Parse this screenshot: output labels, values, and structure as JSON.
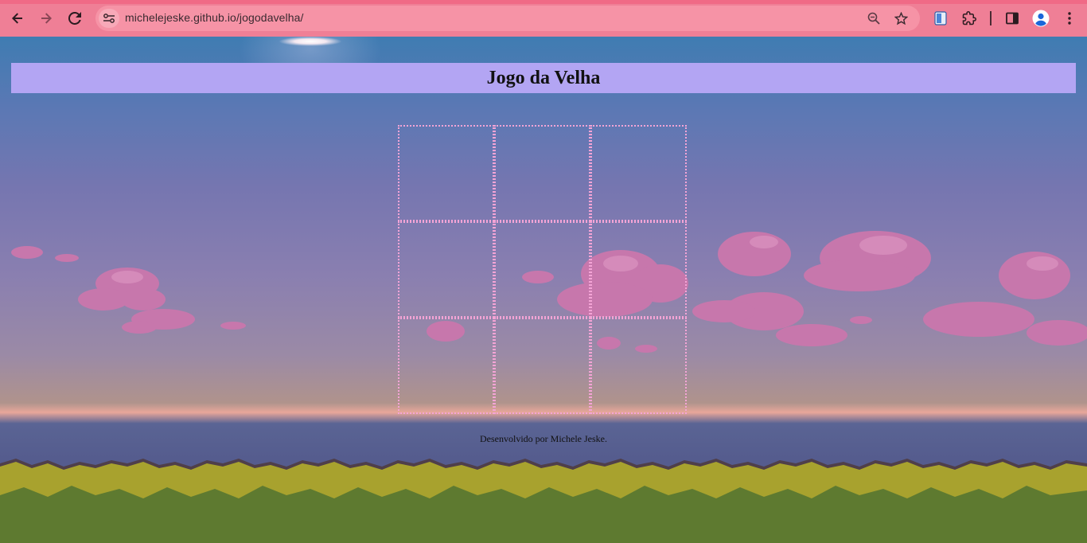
{
  "browser": {
    "url": "michelejeske.github.io/jogodavelha/",
    "back_icon": "arrow-left-icon",
    "forward_icon": "arrow-right-icon",
    "reload_icon": "reload-icon",
    "site_info_icon": "tune-icon",
    "zoom_icon": "zoom-icon",
    "bookmark_icon": "star-icon",
    "extension_icons": [
      "notes-extension-icon",
      "puzzle-icon"
    ],
    "side_panel_icon": "side-panel-icon",
    "profile_icon": "profile-icon",
    "menu_icon": "kebab-menu-icon",
    "colors": {
      "toolbar": "#ef7f96",
      "omnibox": "#f693a6"
    }
  },
  "page": {
    "title": "Jogo da Velha",
    "board": {
      "cells": [
        "",
        "",
        "",
        "",
        "",
        "",
        "",
        "",
        ""
      ]
    },
    "footer": "Desenvolvido por Michele Jeske.",
    "colors": {
      "title_bar": "#b3a5f3",
      "cell_border": "#f4a4d6"
    }
  }
}
